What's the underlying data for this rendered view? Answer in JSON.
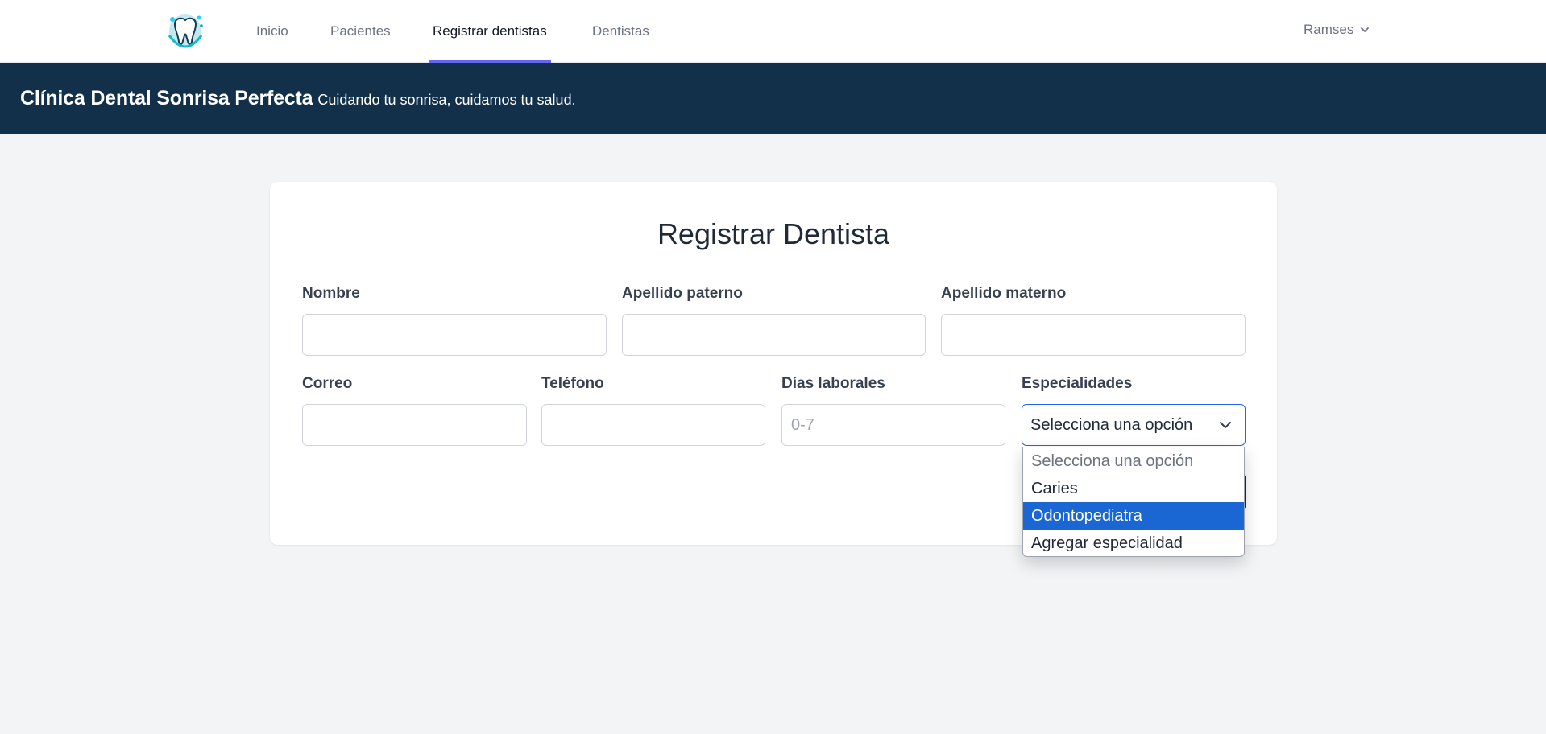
{
  "nav": {
    "links": [
      {
        "label": "Inicio",
        "active": false
      },
      {
        "label": "Pacientes",
        "active": false
      },
      {
        "label": "Registrar dentistas",
        "active": true
      },
      {
        "label": "Dentistas",
        "active": false
      }
    ],
    "user": "Ramses"
  },
  "banner": {
    "title": "Clínica Dental Sonrisa Perfecta",
    "subtitle": "Cuidando tu sonrisa, cuidamos tu salud."
  },
  "form": {
    "title": "Registrar Dentista",
    "fields": {
      "nombre": {
        "label": "Nombre",
        "value": "",
        "placeholder": ""
      },
      "apellido_paterno": {
        "label": "Apellido paterno",
        "value": "",
        "placeholder": ""
      },
      "apellido_materno": {
        "label": "Apellido materno",
        "value": "",
        "placeholder": ""
      },
      "correo": {
        "label": "Correo",
        "value": "",
        "placeholder": ""
      },
      "telefono": {
        "label": "Teléfono",
        "value": "",
        "placeholder": ""
      },
      "dias_laborales": {
        "label": "Días laborales",
        "value": "",
        "placeholder": "0-7"
      },
      "especialidades": {
        "label": "Especialidades",
        "selected": "Selecciona una opción",
        "options": [
          {
            "label": "Selecciona una opción",
            "placeholder": true,
            "highlighted": false
          },
          {
            "label": "Caries",
            "placeholder": false,
            "highlighted": false
          },
          {
            "label": "Odontopediatra",
            "placeholder": false,
            "highlighted": true
          },
          {
            "label": "Agregar especialidad",
            "placeholder": false,
            "highlighted": false
          }
        ]
      }
    }
  },
  "colors": {
    "banner_bg": "#12304a",
    "active_tab_underline": "#6366f1",
    "select_focus_border": "#2563eb",
    "option_highlight": "#1a66d2",
    "page_bg": "#f3f4f6"
  },
  "icons": {
    "logo": "tooth-logo-icon",
    "user_chevron": "chevron-down-icon",
    "select_chevron": "chevron-down-icon"
  }
}
